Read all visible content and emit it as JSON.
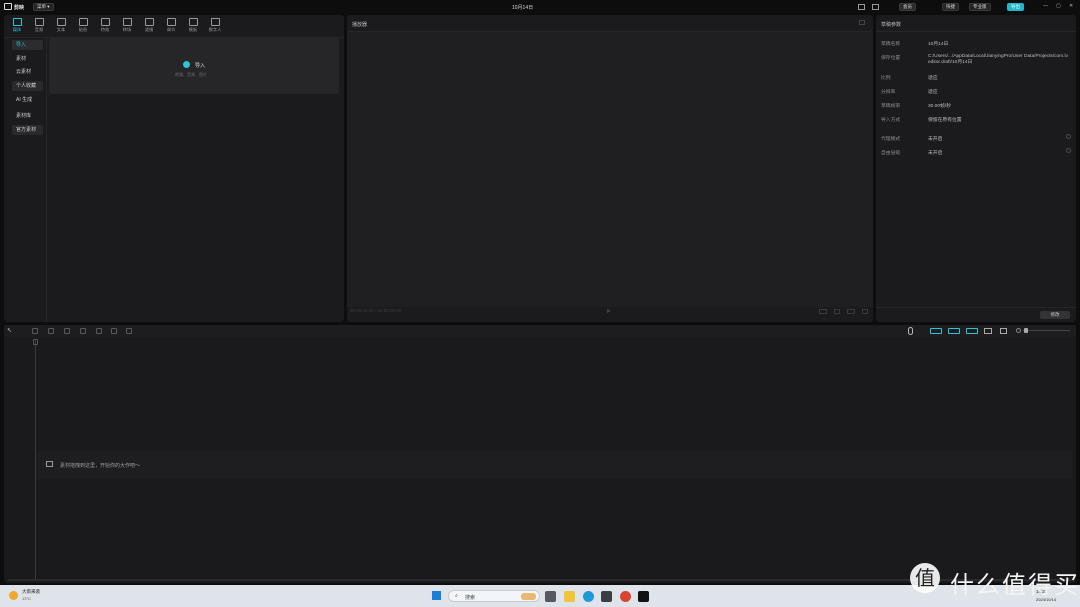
{
  "app": {
    "logo_text": "剪映",
    "menu_label": "菜单",
    "project_title": "10月14日"
  },
  "topbar": {
    "vip_label": "会员",
    "shortcut_label": "快捷",
    "pro_label": "专业版",
    "export_label": "导出"
  },
  "toolbar": {
    "items": [
      {
        "label": "媒体",
        "icon": "media-icon",
        "active": true
      },
      {
        "label": "音频",
        "icon": "audio-icon"
      },
      {
        "label": "文本",
        "icon": "text-icon"
      },
      {
        "label": "贴纸",
        "icon": "sticker-icon"
      },
      {
        "label": "特效",
        "icon": "effects-icon"
      },
      {
        "label": "转场",
        "icon": "transition-icon"
      },
      {
        "label": "滤镜",
        "icon": "filter-icon"
      },
      {
        "label": "调节",
        "icon": "adjust-icon"
      },
      {
        "label": "模板",
        "icon": "template-icon"
      },
      {
        "label": "数字人",
        "icon": "digital-human-icon"
      }
    ]
  },
  "sidebar": {
    "items": [
      "导入",
      "素材",
      "云素材",
      "个人收藏",
      "AI 生成",
      "素材库",
      "官方素材"
    ]
  },
  "import": {
    "label": "导入",
    "hint": "视频、音频、图片"
  },
  "player": {
    "title": "播放器",
    "time": "00:00:00:00 / 00:00:00:00"
  },
  "details": {
    "title": "草稿参数",
    "rows": [
      {
        "key": "草稿名称",
        "value": "10月14日"
      },
      {
        "key": "保存位置",
        "value": "C:/Users/.../AppData/Local/JianyingPro/User Data/Projects/com.lveditor.draft/10月14日"
      },
      {
        "key": "比例",
        "value": "适应"
      },
      {
        "key": "分辨率",
        "value": "适应"
      },
      {
        "key": "草稿帧率",
        "value": "30.00帧/秒"
      },
      {
        "key": "导入方式",
        "value": "保留在原有位置"
      },
      {
        "key": "代理模式",
        "value": "未开启"
      },
      {
        "key": "自由层级",
        "value": "未开启"
      }
    ],
    "edit_label": "修改"
  },
  "timeline": {
    "drop_hint": "素材拖拽到这里，开始你的大作吧～"
  },
  "taskbar": {
    "weather_temp": "大雨来袭",
    "weather_sub": "13°C",
    "search_placeholder": "搜索",
    "clock_time": "14:21",
    "clock_date": "2024/10/14"
  },
  "watermark": {
    "char": "值",
    "text": "什么值得买"
  }
}
